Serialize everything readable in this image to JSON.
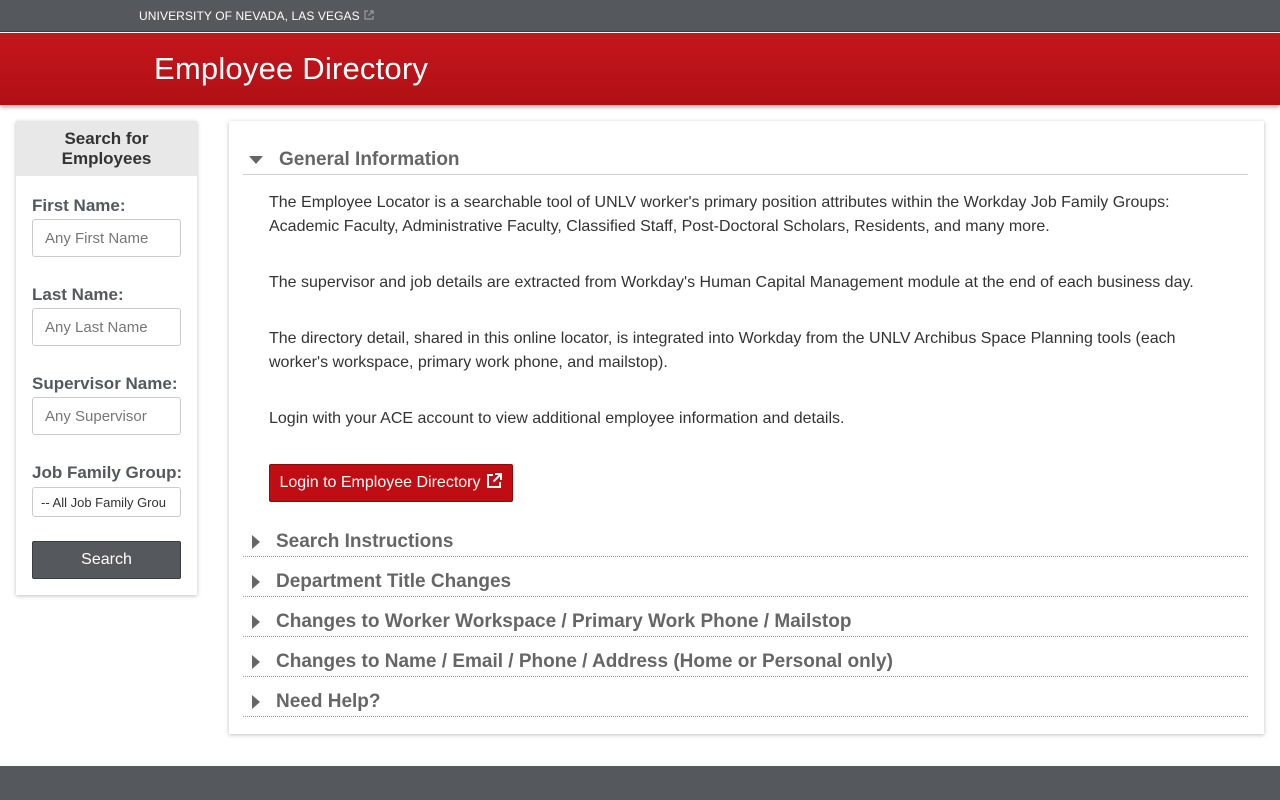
{
  "topbar": {
    "university_link": "UNIVERSITY OF NEVADA, LAS VEGAS",
    "external_icon": "external-link-icon"
  },
  "header": {
    "title": "Employee Directory"
  },
  "sidebar": {
    "heading": "Search for Employees",
    "first_name_label": "First Name:",
    "first_name_placeholder": "Any First Name",
    "last_name_label": "Last Name:",
    "last_name_placeholder": "Any Last Name",
    "supervisor_label": "Supervisor Name:",
    "supervisor_placeholder": "Any Supervisor",
    "job_family_label": "Job Family Group:",
    "job_family_selected": "-- All Job Family Grou",
    "search_button": "Search"
  },
  "main": {
    "general": {
      "title": "General Information",
      "paragraphs": [
        "The Employee Locator is a searchable tool of UNLV worker's primary position attributes within the Workday Job Family Groups: Academic Faculty, Administrative Faculty, Classified Staff, Post-Doctoral Scholars, Residents, and many more.",
        "The supervisor and job details are extracted from Workday's Human Capital Management module at the end of each business day.",
        "The directory detail, shared in this online locator, is integrated into Workday from the UNLV Archibus Space Planning tools (each worker's workspace, primary work phone, and mailstop).",
        "Login with your ACE account to view additional employee information and details."
      ],
      "login_button": "Login to Employee Directory"
    },
    "sections": [
      "Search Instructions",
      "Department Title Changes",
      "Changes to Worker Workspace / Primary Work Phone / Mailstop",
      "Changes to Name / Email / Phone / Address (Home or Personal only)",
      "Need Help?"
    ]
  },
  "colors": {
    "header_red": "#c4161c",
    "bar_gray": "#55585c",
    "button_red": "#c00d13"
  }
}
